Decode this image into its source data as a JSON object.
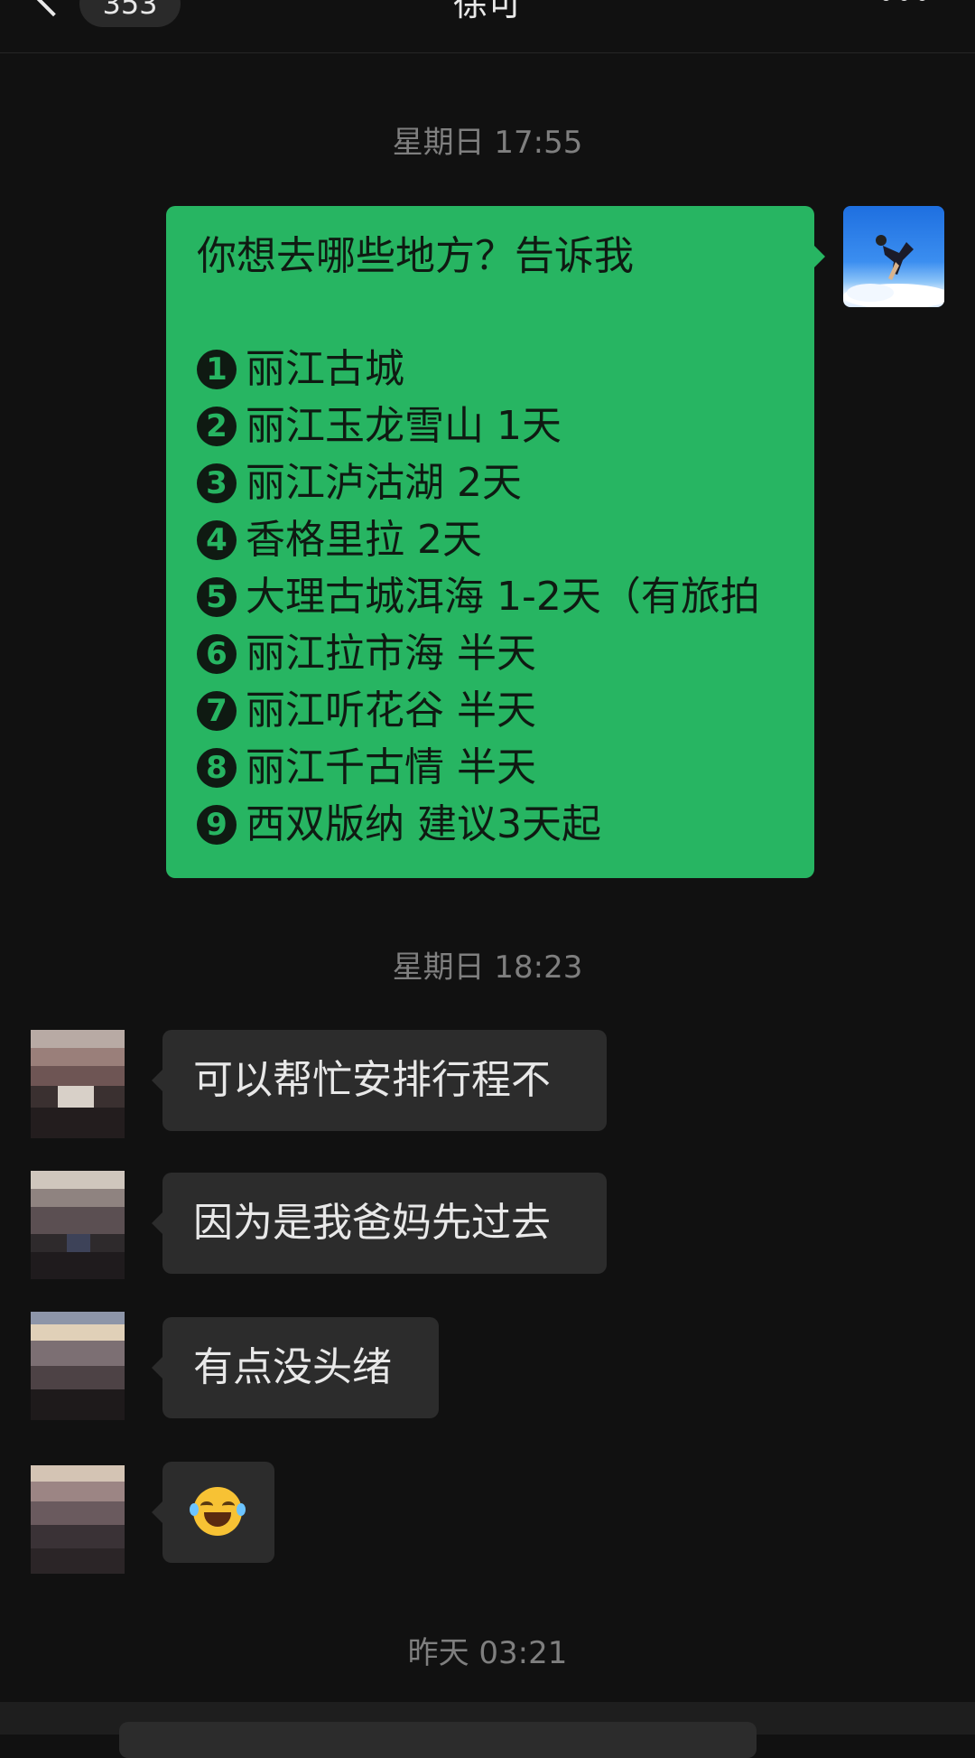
{
  "header": {
    "unread_count": "353",
    "title": "徐可",
    "icons": [
      "back-icon",
      "more-icon"
    ]
  },
  "timestamps": [
    "星期日 17:55",
    "星期日 18:23",
    "昨天 03:21"
  ],
  "outgoing": {
    "intro": "你想去哪些地方？告诉我",
    "numbers": [
      "1",
      "2",
      "3",
      "4",
      "5",
      "6",
      "7",
      "8",
      "9"
    ],
    "items": [
      "丽江古城",
      "丽江玉龙雪山 1天",
      "丽江泸沽湖 2天",
      "香格里拉 2天",
      "大理古城洱海 1-2天（有旅拍",
      "丽江拉市海 半天",
      "丽江听花谷 半天",
      "丽江千古情 半天",
      "西双版纳 建议3天起"
    ],
    "bubble_color": "#27b562"
  },
  "incoming": [
    "可以帮忙安排行程不",
    "因为是我爸妈先过去",
    "有点没头绪",
    "😂"
  ],
  "incoming_emoji_icon": "face-with-tears-of-joy-icon",
  "colors": {
    "background": "#111111",
    "incoming_bubble": "#2c2c2c"
  }
}
